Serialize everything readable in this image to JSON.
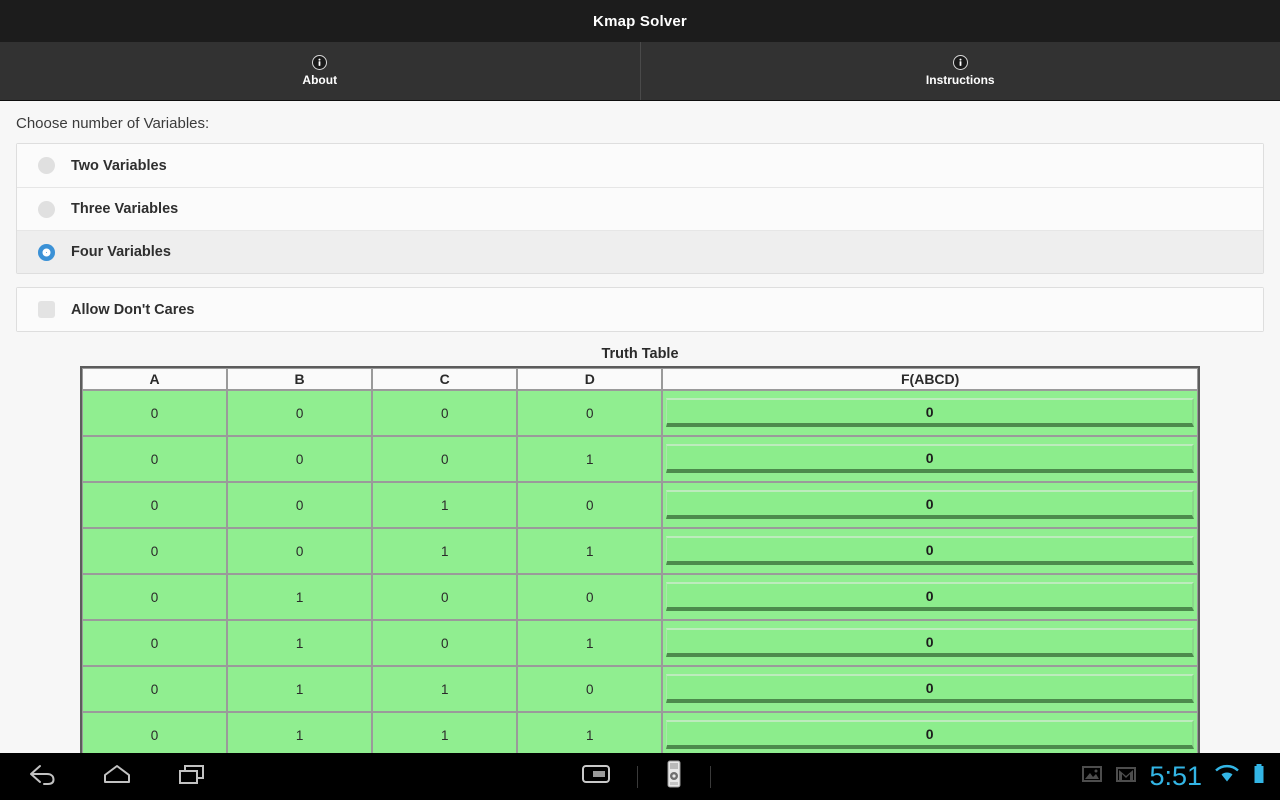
{
  "app": {
    "title": "Kmap Solver"
  },
  "tabs": [
    {
      "label": "About",
      "icon": "info-icon"
    },
    {
      "label": "Instructions",
      "icon": "info-icon"
    }
  ],
  "options": {
    "prompt": "Choose number of Variables:",
    "radios": [
      {
        "label": "Two Variables",
        "selected": false
      },
      {
        "label": "Three Variables",
        "selected": false
      },
      {
        "label": "Four Variables",
        "selected": true
      }
    ],
    "checkbox": {
      "label": "Allow Don't Cares",
      "checked": false
    }
  },
  "truth_table": {
    "title": "Truth Table",
    "headers": [
      "A",
      "B",
      "C",
      "D",
      "F(ABCD)"
    ],
    "rows": [
      {
        "A": "0",
        "B": "0",
        "C": "0",
        "D": "0",
        "F": "0"
      },
      {
        "A": "0",
        "B": "0",
        "C": "0",
        "D": "1",
        "F": "0"
      },
      {
        "A": "0",
        "B": "0",
        "C": "1",
        "D": "0",
        "F": "0"
      },
      {
        "A": "0",
        "B": "0",
        "C": "1",
        "D": "1",
        "F": "0"
      },
      {
        "A": "0",
        "B": "1",
        "C": "0",
        "D": "0",
        "F": "0"
      },
      {
        "A": "0",
        "B": "1",
        "C": "0",
        "D": "1",
        "F": "0"
      },
      {
        "A": "0",
        "B": "1",
        "C": "1",
        "D": "0",
        "F": "0"
      },
      {
        "A": "0",
        "B": "1",
        "C": "1",
        "D": "1",
        "F": "0"
      }
    ]
  },
  "navbar": {
    "back": "back-icon",
    "home": "home-icon",
    "recents": "recents-icon",
    "screenshot": "screenshot-icon",
    "remote": "remote-control-icon",
    "gallery": "image-notification-icon",
    "mail": "gmail-notification-icon",
    "clock": "5:51",
    "wifi": "wifi-icon",
    "battery": "battery-icon"
  },
  "colors": {
    "titlebar": "#1c1c1c",
    "tabbar": "#323232",
    "cell_green": "#90ee90",
    "radio_selected": "#3b91d6",
    "status_blue": "#33b5e5"
  }
}
